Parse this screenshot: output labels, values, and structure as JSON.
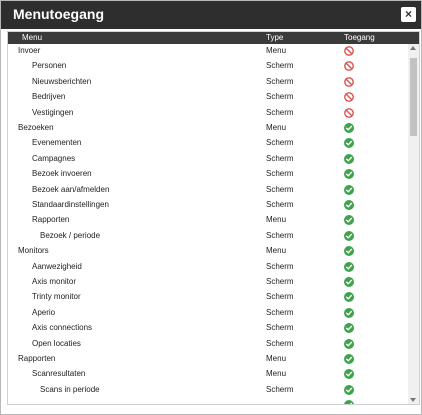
{
  "dialog": {
    "title": "Menutoegang",
    "close_label": "×"
  },
  "table": {
    "headers": {
      "menu": "Menu",
      "type": "Type",
      "access": "Toegang"
    },
    "rows": [
      {
        "label": "Invoer",
        "level": 0,
        "type": "Menu",
        "access": "denied"
      },
      {
        "label": "Personen",
        "level": 1,
        "type": "Scherm",
        "access": "denied"
      },
      {
        "label": "Nieuwsberichten",
        "level": 1,
        "type": "Scherm",
        "access": "denied"
      },
      {
        "label": "Bedrijven",
        "level": 1,
        "type": "Scherm",
        "access": "denied"
      },
      {
        "label": "Vestigingen",
        "level": 1,
        "type": "Scherm",
        "access": "denied"
      },
      {
        "label": "Bezoeken",
        "level": 0,
        "type": "Menu",
        "access": "granted"
      },
      {
        "label": "Evenementen",
        "level": 1,
        "type": "Scherm",
        "access": "granted"
      },
      {
        "label": "Campagnes",
        "level": 1,
        "type": "Scherm",
        "access": "granted"
      },
      {
        "label": "Bezoek invoeren",
        "level": 1,
        "type": "Scherm",
        "access": "granted"
      },
      {
        "label": "Bezoek aan/afmelden",
        "level": 1,
        "type": "Scherm",
        "access": "granted"
      },
      {
        "label": "Standaardinstellingen",
        "level": 1,
        "type": "Scherm",
        "access": "granted"
      },
      {
        "label": "Rapporten",
        "level": 1,
        "type": "Menu",
        "access": "granted"
      },
      {
        "label": "Bezoek / periode",
        "level": 2,
        "type": "Scherm",
        "access": "granted"
      },
      {
        "label": "Monitors",
        "level": 0,
        "type": "Menu",
        "access": "granted"
      },
      {
        "label": "Aanwezigheid",
        "level": 1,
        "type": "Scherm",
        "access": "granted"
      },
      {
        "label": "Axis monitor",
        "level": 1,
        "type": "Scherm",
        "access": "granted"
      },
      {
        "label": "Trinty monitor",
        "level": 1,
        "type": "Scherm",
        "access": "granted"
      },
      {
        "label": "Aperio",
        "level": 1,
        "type": "Scherm",
        "access": "granted"
      },
      {
        "label": "Axis connections",
        "level": 1,
        "type": "Scherm",
        "access": "granted"
      },
      {
        "label": "Open locaties",
        "level": 1,
        "type": "Scherm",
        "access": "granted"
      },
      {
        "label": "Rapporten",
        "level": 0,
        "type": "Menu",
        "access": "granted"
      },
      {
        "label": "Scanresultaten",
        "level": 1,
        "type": "Menu",
        "access": "granted"
      },
      {
        "label": "Scans in periode",
        "level": 2,
        "type": "Scherm",
        "access": "granted"
      },
      {
        "label": "",
        "level": 2,
        "type": "",
        "access": "granted"
      }
    ]
  },
  "colors": {
    "granted": "#3fa34d",
    "denied": "#d9534f"
  },
  "icons": {
    "granted": "check-circle-icon",
    "denied": "no-entry-icon"
  }
}
